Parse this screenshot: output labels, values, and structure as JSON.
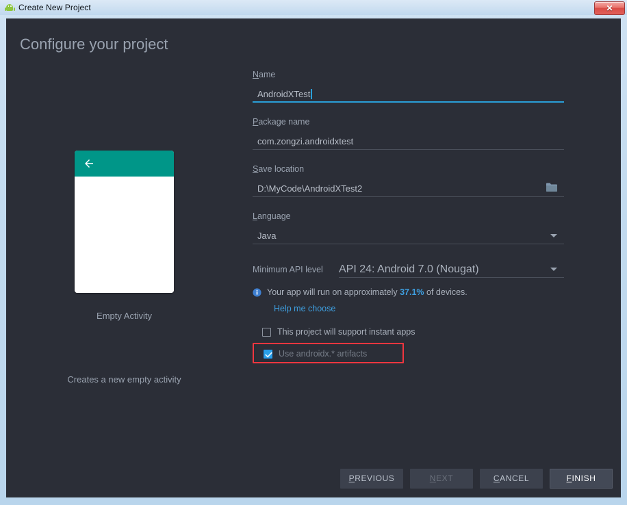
{
  "window": {
    "title": "Create New Project",
    "icon": "android-robot-icon",
    "close_label": "✕"
  },
  "page": {
    "title": "Configure your project"
  },
  "preview": {
    "template_name": "Empty Activity",
    "template_description": "Creates a new empty activity",
    "appbar_color": "#009688",
    "back_icon": "arrow-left-icon"
  },
  "form": {
    "name": {
      "label_mnemonic": "N",
      "label_rest": "ame",
      "value": "AndroidXTest",
      "focused": true
    },
    "package_name": {
      "label_mnemonic": "P",
      "label_rest": "ackage name",
      "value": "com.zongzi.androidxtest"
    },
    "save_location": {
      "label_mnemonic": "S",
      "label_rest": "ave location",
      "value": "D:\\MyCode\\AndroidXTest2",
      "browse_icon": "folder-icon"
    },
    "language": {
      "label_mnemonic": "L",
      "label_rest": "anguage",
      "value": "Java",
      "dropdown_icon": "chevron-down-icon"
    },
    "min_api": {
      "label": "Minimum API level",
      "value": "API 24: Android 7.0 (Nougat)",
      "dropdown_icon": "chevron-down-icon"
    },
    "api_info": {
      "icon": "info-icon",
      "text_before": "Your app will run on approximately ",
      "percent": "37.1%",
      "text_after": " of devices.",
      "accent_color": "#3e9fe0"
    },
    "help_link": "Help me choose",
    "instant_apps_checkbox": {
      "label": "This project will support instant apps",
      "checked": false
    },
    "androidx_checkbox": {
      "label": "Use androidx.* artifacts",
      "checked": true,
      "disabled": true,
      "highlight_color": "#f0363f"
    }
  },
  "footer": {
    "previous": {
      "mnemonic": "P",
      "rest": "REVIOUS"
    },
    "next": {
      "mnemonic": "N",
      "rest": "EXT",
      "disabled": true
    },
    "cancel": {
      "mnemonic": "C",
      "rest": "ANCEL"
    },
    "finish": {
      "mnemonic": "F",
      "rest": "INISH",
      "default": true
    }
  }
}
